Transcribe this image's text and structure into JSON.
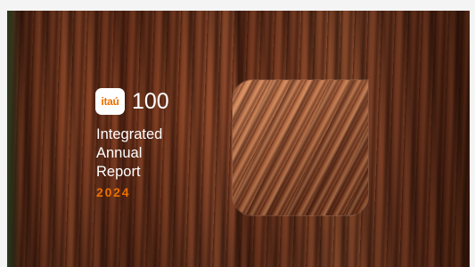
{
  "cover": {
    "logo": {
      "badge_text": "itaú",
      "hundred": "100"
    },
    "title_lines": [
      "Integrated",
      "Annual",
      "Report"
    ],
    "year": "2024",
    "colors": {
      "brand_orange": "#ec7000",
      "title_text": "#ffffff",
      "badge_bg": "#ffffff"
    },
    "background_image": "redwood-trunk-photo",
    "inset_image": "bark-closeup-photo"
  }
}
